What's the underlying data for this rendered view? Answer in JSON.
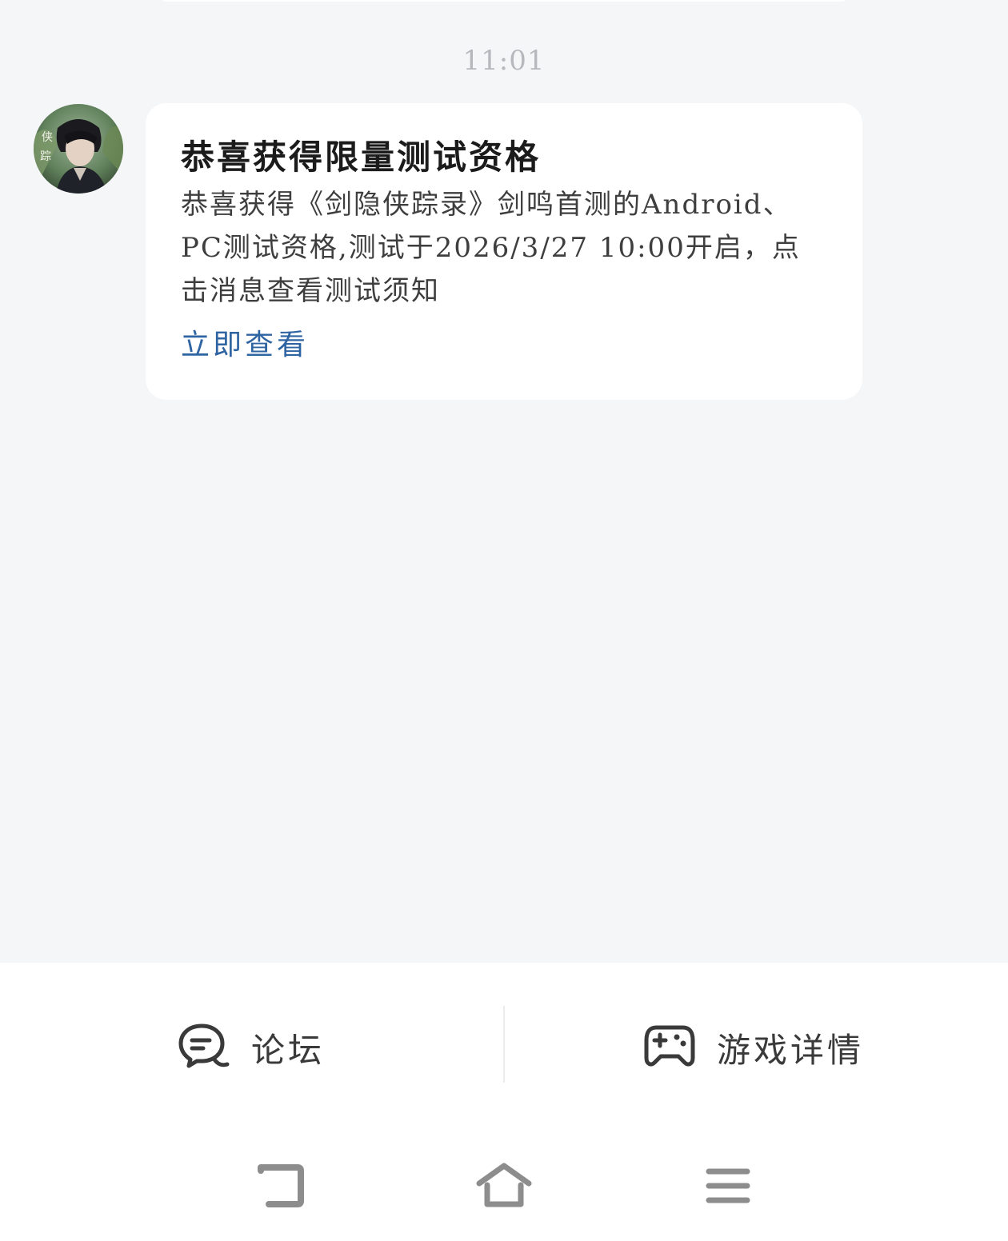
{
  "timestamp": "11:01",
  "message": {
    "title": "恭喜获得限量测试资格",
    "body": "恭喜获得《剑隐侠踪录》剑鸣首测的Android、PC测试资格,测试于2026/3/27 10:00开启，点击消息查看测试须知",
    "link_label": "立即查看"
  },
  "actions": {
    "forum_label": "论坛",
    "game_details_label": "游戏详情"
  },
  "nav": {
    "back_icon": "back-icon",
    "home_icon": "home-icon",
    "menu_icon": "menu-icon"
  },
  "colors": {
    "background": "#f5f6f8",
    "card": "#ffffff",
    "link": "#2f64a3",
    "timestamp": "#b6b8bd"
  }
}
